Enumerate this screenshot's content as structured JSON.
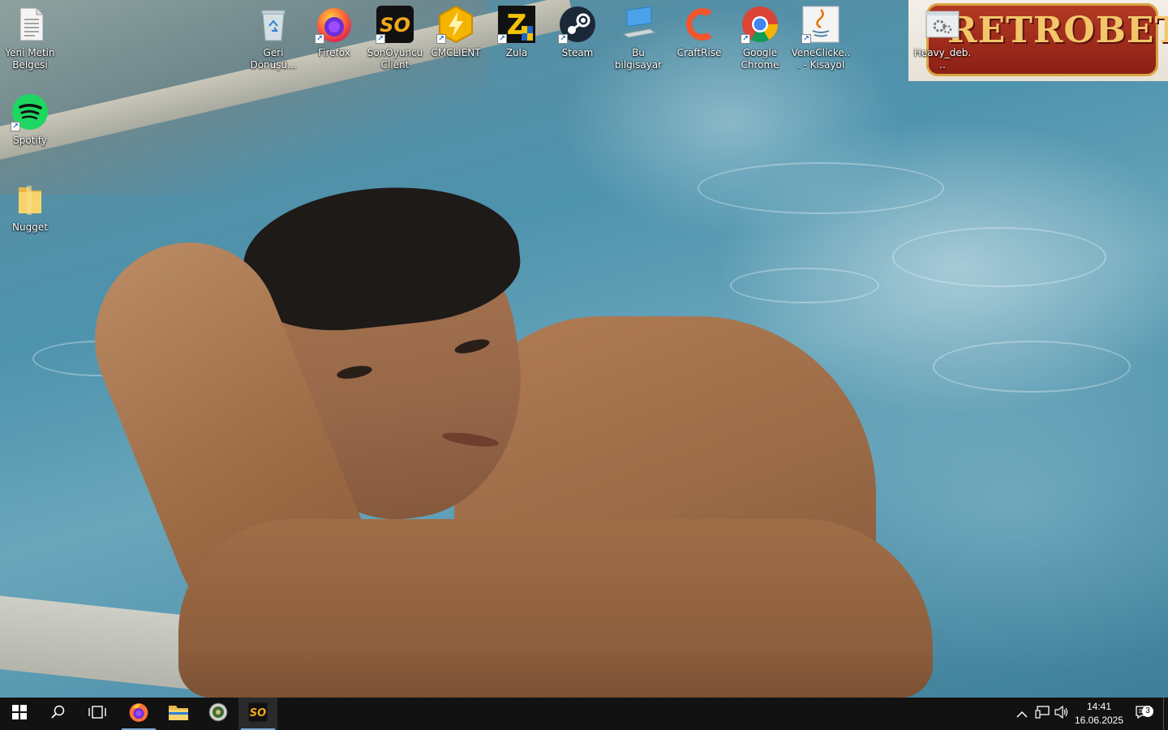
{
  "desktop": {
    "icons": [
      {
        "label": "Yeni Metin Belgesi",
        "icon": "text-document-icon"
      },
      {
        "label": "Spotify",
        "icon": "spotify-icon"
      },
      {
        "label": "Nugget",
        "icon": "folder-icon"
      },
      {
        "label": "Geri Dönüşü...",
        "icon": "recycle-bin-icon"
      },
      {
        "label": "Firefox",
        "icon": "firefox-icon"
      },
      {
        "label": "SonOyuncu Client",
        "icon": "sonoyuncu-icon"
      },
      {
        "label": "CMCLIENT",
        "icon": "cmclient-icon"
      },
      {
        "label": "Zula",
        "icon": "zula-icon"
      },
      {
        "label": "Steam",
        "icon": "steam-icon"
      },
      {
        "label": "Bu bilgisayar",
        "icon": "computer-icon"
      },
      {
        "label": "CraftRise",
        "icon": "craftrise-icon"
      },
      {
        "label": "Google Chrome",
        "icon": "chrome-icon"
      },
      {
        "label": "VeneClicke... - Kısayol",
        "icon": "java-icon"
      },
      {
        "label": "Heavy_deb...",
        "icon": "settings-app-icon"
      }
    ],
    "wallpaper_banner": "RETROBET"
  },
  "taskbar": {
    "start": "windows-start-icon",
    "search": "search-icon",
    "task_view": "task-view-icon",
    "pinned": [
      {
        "name": "Firefox",
        "icon": "firefox-icon",
        "active": true
      },
      {
        "name": "File Explorer",
        "icon": "folder-icon",
        "active": false
      },
      {
        "name": "App",
        "icon": "round-app-icon",
        "active": false
      },
      {
        "name": "SonOyuncu Client",
        "icon": "sonoyuncu-icon",
        "active": true
      }
    ],
    "tray": {
      "time": "14:41",
      "date": "16.06.2025",
      "notification_count": "3"
    }
  },
  "colors": {
    "taskbar_bg": "#121212",
    "accent_underline": "#7aa7d8"
  }
}
